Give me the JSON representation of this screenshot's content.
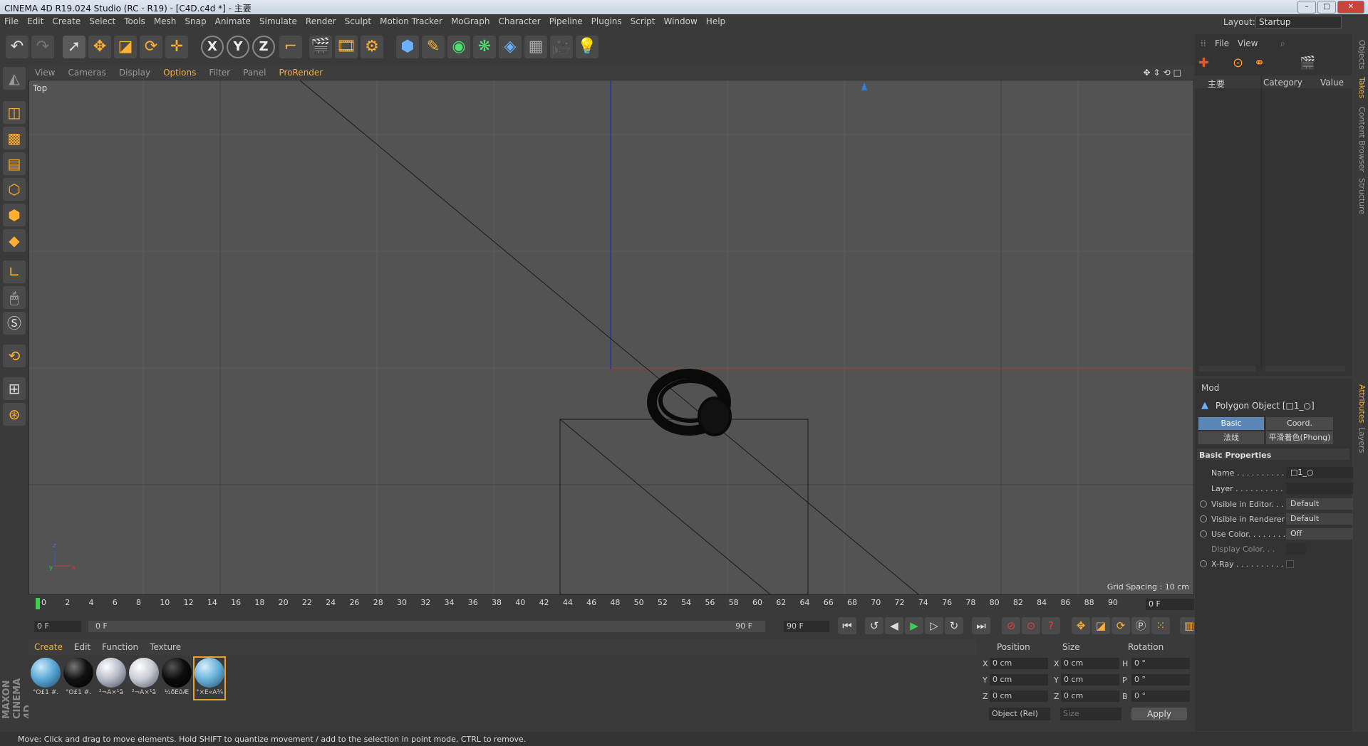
{
  "window": {
    "title": "CINEMA 4D R19.024 Studio (RC - R19) - [C4D.c4d *] - 主要"
  },
  "menu": [
    "File",
    "Edit",
    "Create",
    "Select",
    "Tools",
    "Mesh",
    "Snap",
    "Animate",
    "Simulate",
    "Render",
    "Sculpt",
    "Motion Tracker",
    "MoGraph",
    "Character",
    "Pipeline",
    "Plugins",
    "Script",
    "Window",
    "Help"
  ],
  "layout": {
    "label": "Layout:",
    "value": "Startup"
  },
  "viewport": {
    "menu": [
      "View",
      "Cameras",
      "Display",
      "Options",
      "Filter",
      "Panel",
      "ProRender"
    ],
    "name": "Top",
    "grid_spacing": "Grid Spacing : 10 cm"
  },
  "timeline": {
    "ticks": [
      "0",
      "2",
      "4",
      "6",
      "8",
      "10",
      "12",
      "14",
      "16",
      "18",
      "20",
      "22",
      "24",
      "26",
      "28",
      "30",
      "32",
      "34",
      "36",
      "38",
      "40",
      "42",
      "44",
      "46",
      "48",
      "50",
      "52",
      "54",
      "56",
      "58",
      "60",
      "62",
      "64",
      "66",
      "68",
      "70",
      "72",
      "74",
      "76",
      "78",
      "80",
      "82",
      "84",
      "86",
      "88",
      "90"
    ],
    "current_frame": "0 F",
    "start": "0 F",
    "range_start": "0 F",
    "range_end": "90 F",
    "end": "90 F"
  },
  "materials": {
    "menu": [
      "Create",
      "Edit",
      "Function",
      "Texture"
    ],
    "items": [
      {
        "label": "°Ó£1 #.",
        "color": "#5aa8d8"
      },
      {
        "label": "°Ó£1 #.",
        "color": "#111111"
      },
      {
        "label": "²¬Ã×¹ã",
        "color": "#b8bcc8"
      },
      {
        "label": "²¬Ã×¹ã",
        "color": "#c8ccd4"
      },
      {
        "label": "½ðÊôÆ",
        "color": "#0c0c0c"
      },
      {
        "label": "°×É«Ã¾",
        "color": "#6ab4dc"
      }
    ]
  },
  "coords": {
    "headers": [
      "Position",
      "Size",
      "Rotation"
    ],
    "rows": [
      {
        "axis": "X",
        "pos": "0 cm",
        "saxis": "X",
        "size": "0 cm",
        "raxis": "H",
        "rot": "0 °"
      },
      {
        "axis": "Y",
        "pos": "0 cm",
        "saxis": "Y",
        "size": "0 cm",
        "raxis": "P",
        "rot": "0 °"
      },
      {
        "axis": "Z",
        "pos": "0 cm",
        "saxis": "Z",
        "size": "0 cm",
        "raxis": "B",
        "rot": "0 °"
      }
    ],
    "mode": "Object (Rel)",
    "size_mode": "Size",
    "apply": "Apply"
  },
  "status": "Move: Click and drag to move elements. Hold SHIFT to quantize movement / add to the selection in point mode, CTRL to remove.",
  "objects": {
    "menu": [
      "File",
      "View"
    ],
    "cols": [
      "主要",
      "Category",
      "Value"
    ]
  },
  "attributes": {
    "mode": "Mod",
    "title": "Polygon Object [□1_○]",
    "tabs": [
      "Basic",
      "Coord.",
      "法线",
      "平滑着色(Phong)"
    ],
    "section": "Basic Properties",
    "rows": [
      {
        "label": "Name . . . . . . . . . . .",
        "value": "□1_○"
      },
      {
        "label": "Layer . . . . . . . . . . .",
        "value": ""
      },
      {
        "label": "Visible in Editor. . .",
        "value": "Default"
      },
      {
        "label": "Visible in Renderer",
        "value": "Default"
      },
      {
        "label": "Use Color. . . . . . . .",
        "value": "Off"
      },
      {
        "label": "Display Color. . .",
        "value": ""
      },
      {
        "label": "X-Ray . . . . . . . . . .",
        "value": ""
      }
    ]
  },
  "side_tabs": [
    "Objects",
    "Takes",
    "Content Browser",
    "Structure",
    "Attributes",
    "Layers"
  ]
}
